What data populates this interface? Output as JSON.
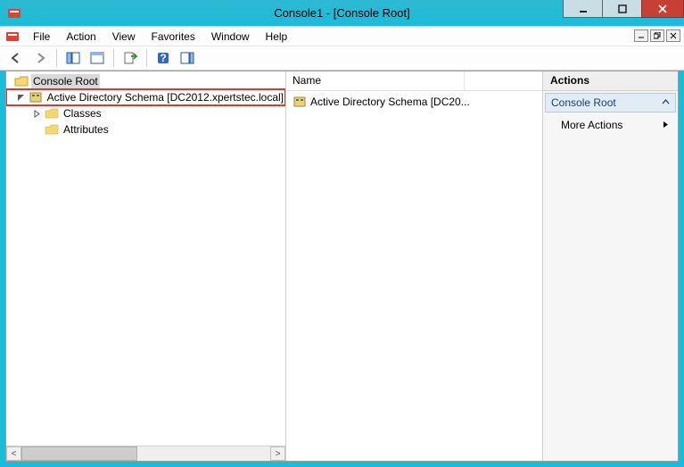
{
  "titlebar": {
    "title": "Console1 - [Console Root]"
  },
  "menu": {
    "items": [
      "File",
      "Action",
      "View",
      "Favorites",
      "Window",
      "Help"
    ]
  },
  "toolbar": {
    "back": "back-icon",
    "forward": "forward-icon",
    "up": "up-icon",
    "show_hide": "show-hide-tree-icon",
    "export": "export-list-icon",
    "help": "help-icon",
    "props": "properties-icon"
  },
  "tree": {
    "root": {
      "label": "Console Root"
    },
    "schema": {
      "label": "Active Directory Schema [DC2012.xpertstec.local]"
    },
    "children": [
      {
        "label": "Classes"
      },
      {
        "label": "Attributes"
      }
    ]
  },
  "list": {
    "columns": [
      "Name"
    ],
    "rows": [
      {
        "name": "Active Directory Schema [DC20..."
      }
    ]
  },
  "actions": {
    "title": "Actions",
    "group": "Console Root",
    "items": [
      "More Actions"
    ]
  }
}
